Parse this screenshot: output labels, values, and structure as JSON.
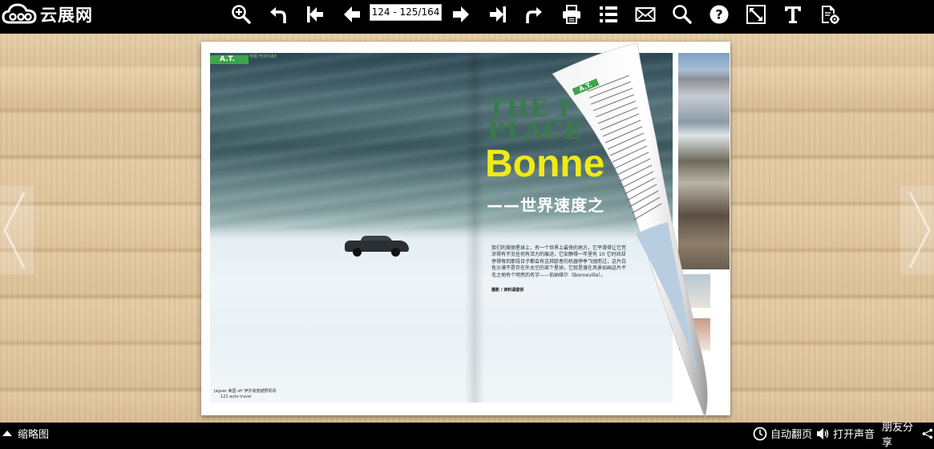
{
  "toolbar": {
    "logo_text": "云展网",
    "page_indicator": "124 - 125/164",
    "buttons": [
      {
        "name": "zoom-in-icon"
      },
      {
        "name": "undo-icon"
      },
      {
        "name": "first-page-icon"
      },
      {
        "name": "prev-page-icon"
      },
      {
        "name": "next-page-icon"
      },
      {
        "name": "last-page-icon"
      },
      {
        "name": "redo-icon"
      },
      {
        "name": "print-icon"
      },
      {
        "name": "table-of-contents-icon"
      },
      {
        "name": "email-icon"
      },
      {
        "name": "search-icon"
      },
      {
        "name": "help-icon"
      },
      {
        "name": "fullscreen-icon"
      },
      {
        "name": "text-icon"
      },
      {
        "name": "settings-icon"
      }
    ]
  },
  "magazine": {
    "section_tag": "A.T.",
    "section_sub": "专题 FEATURE",
    "title_en": "THE F\nPLACE",
    "title_yellow": "Bonne",
    "title_zh": "——世界速度之",
    "body": "我们的美丽星球上，有一个世界上最快的地方，它平滑得让它荒凉得有不见任何有活力的痕迹，它安静得一年里有 10 它时间却停得每到那段日子都会有这其欧者的机器停季飞驰而过，这片白色沙漠不是存在外太空的某个星球，它就是落在风景如画这片不毛之地有个明亮的名字——伯纳维尔（Bonneville）。",
    "credit": "摄影 / 资料请提供",
    "footer_line1": "jaguar 美国 xfr 伊莎速度越野现场",
    "footer_line2": "122  auto travel",
    "curl_tag": "A.T."
  },
  "bottombar": {
    "thumbnail_label": "缩略图",
    "autoflip_label": "自动翻页",
    "sound_label": "打开声音",
    "share_label": "朋友分享"
  },
  "colors": {
    "toolbar_bg": "#000000",
    "accent_green": "#3ea54a",
    "title_yellow": "#f0ea16"
  }
}
